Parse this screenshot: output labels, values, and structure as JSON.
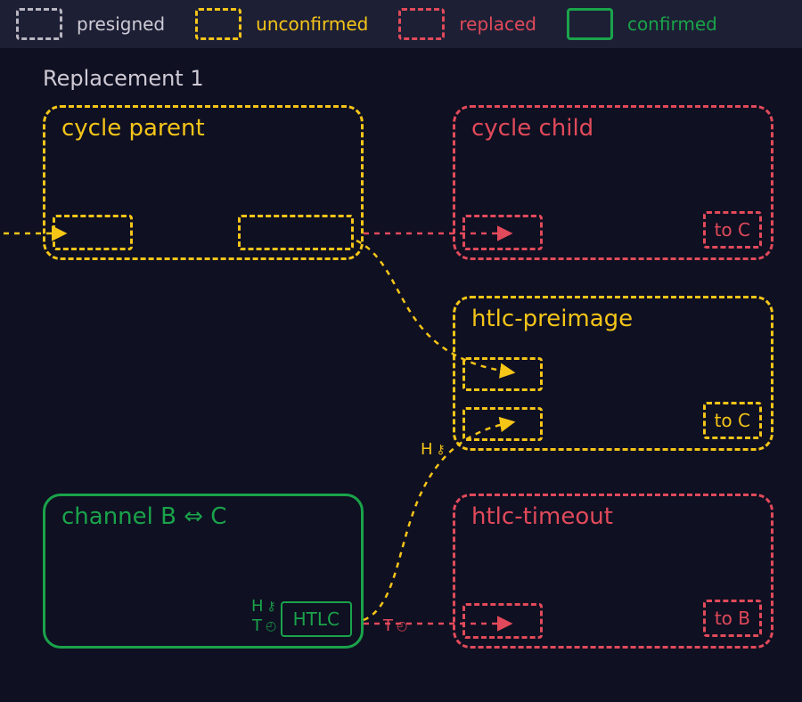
{
  "legend": {
    "presigned": "presigned",
    "unconfirmed": "unconfirmed",
    "replaced": "replaced",
    "confirmed": "confirmed"
  },
  "section_title": "Replacement 1",
  "boxes": {
    "cycle_parent": {
      "title": "cycle parent"
    },
    "cycle_child": {
      "title": "cycle child",
      "out_label": "to C"
    },
    "htlc_preimage": {
      "title": "htlc-preimage",
      "out_label": "to C"
    },
    "htlc_timeout": {
      "title": "htlc-timeout",
      "out_label": "to B"
    },
    "channel": {
      "title": "channel B ⇔ C",
      "out_label": "HTLC"
    }
  },
  "annotations": {
    "h_key_top": {
      "letter": "H",
      "glyph": "⚷"
    },
    "h_key_bottom": {
      "letter": "H",
      "glyph": "⚷"
    },
    "t_clock_g": {
      "letter": "T",
      "glyph": "◴"
    },
    "t_clock_r": {
      "letter": "T",
      "glyph": "◴"
    }
  },
  "colors": {
    "bg": "#0f1022",
    "panel": "#1d1f35",
    "presigned": "#b9b6c1",
    "unconfirmed": "#f5c518",
    "replaced": "#e14a5a",
    "confirmed": "#1aa34a",
    "text_muted": "#cfcad5"
  }
}
